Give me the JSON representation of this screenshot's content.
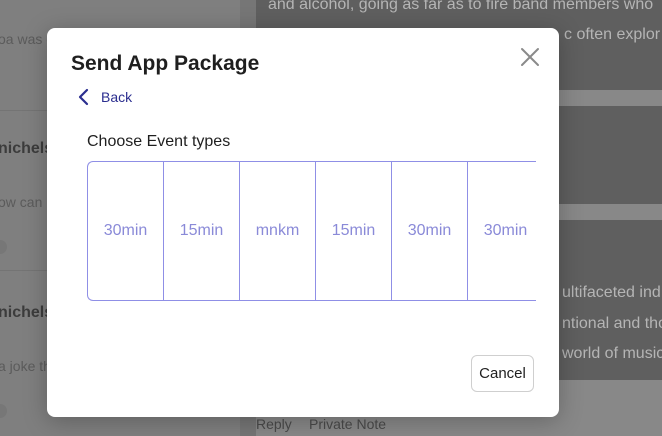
{
  "background": {
    "left_snippets": [
      "oa was c",
      "nichels",
      "ow can",
      "nichels",
      "a joke th"
    ],
    "right_snippets": [
      "and alcohol, going as far as to fire band members who",
      "c often explor",
      "ultifaceted ind",
      "ntional and tho",
      "world of music"
    ],
    "footer_links": [
      "Reply",
      "Private Note"
    ]
  },
  "modal": {
    "title": "Send App Package",
    "back_label": "Back",
    "section_label": "Choose Event types",
    "event_types": [
      "30min",
      "15min",
      "mnkm",
      "15min",
      "30min",
      "30min"
    ],
    "cancel_label": "Cancel",
    "icons": {
      "close": "close-icon",
      "back": "chevron-left-icon"
    },
    "colors": {
      "accent": "#2b2e8f",
      "tile_border": "#8f8fe6",
      "tile_text": "#8a8ad8"
    }
  }
}
